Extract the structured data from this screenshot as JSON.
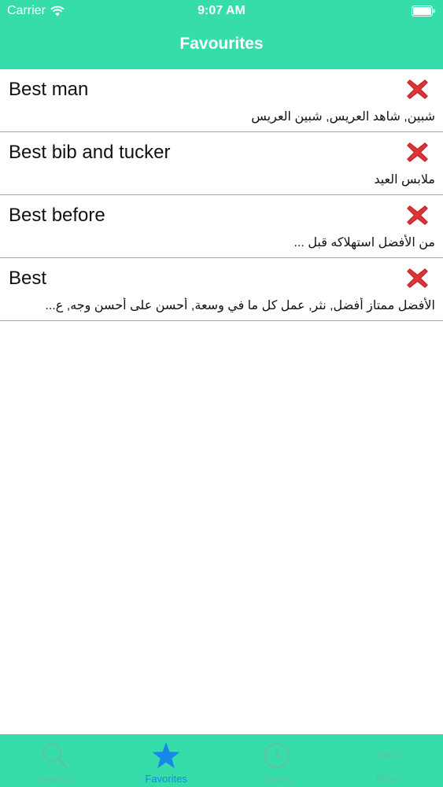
{
  "status_bar": {
    "carrier": "Carrier",
    "time": "9:07 AM"
  },
  "header": {
    "title": "Favourites"
  },
  "favourites": [
    {
      "term": "Best man",
      "translation": "شبين, شاهد العريس, شبين العريس"
    },
    {
      "term": "Best bib and tucker",
      "translation": "ملابس العيد"
    },
    {
      "term": "Best before",
      "translation": "من الأفضل استهلاكه قبل ..."
    },
    {
      "term": "Best",
      "translation": "الأفضل ممتاز أفضل, نثر, عمل كل ما في وسعة, أحسن على أحسن وجه, ع..."
    }
  ],
  "tab_bar": {
    "tabs": [
      {
        "label": "Search",
        "icon": "search-icon",
        "active": false
      },
      {
        "label": "Favorites",
        "icon": "star-icon",
        "active": true
      },
      {
        "label": "History",
        "icon": "clock-icon",
        "active": false
      },
      {
        "label": "More",
        "icon": "more-icon",
        "active": false
      }
    ]
  },
  "colors": {
    "accent": "#37dcab",
    "active_tab": "#1787e8",
    "delete": "#e0343a"
  }
}
